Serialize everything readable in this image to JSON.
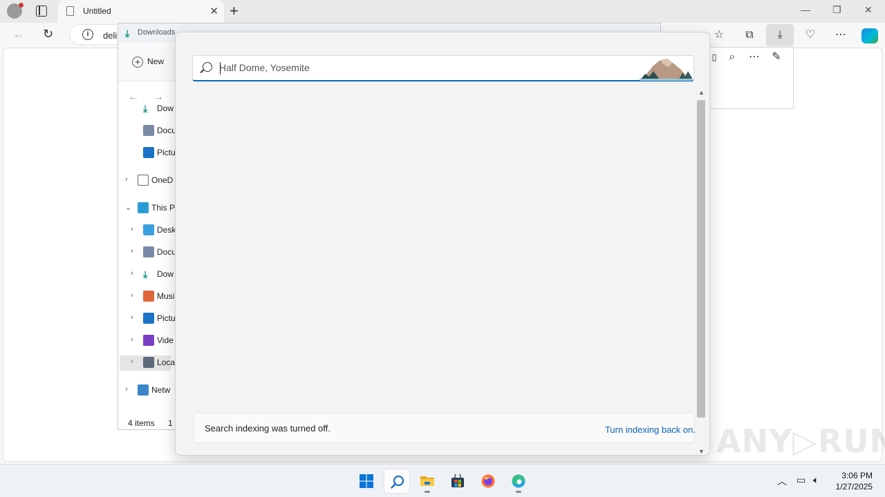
{
  "browser": {
    "tab_title": "Untitled",
    "tab_close": "✕",
    "new_tab": "+",
    "address_text": "deli",
    "window_controls": [
      "—",
      "❐",
      "✕"
    ],
    "toolbar_icons": [
      "split-screen-icon",
      "favorites-icon",
      "collections-icon",
      "downloads-icon",
      "performance-icon",
      "more-icon",
      "copilot-icon"
    ]
  },
  "explorer": {
    "title": "Downloads",
    "new_label": "New",
    "nav_items": [
      {
        "label": "Dow",
        "icon": "download-icon",
        "indent": 1
      },
      {
        "label": "Docu",
        "icon": "document-icon",
        "indent": 1
      },
      {
        "label": "Pictu",
        "icon": "pictures-icon",
        "indent": 1
      },
      {
        "label": "OneD",
        "icon": "onedrive-icon",
        "indent": 0
      },
      {
        "label": "This P",
        "icon": "pc-icon",
        "indent": 0
      },
      {
        "label": "Deskt",
        "icon": "desktop-icon",
        "indent": 1
      },
      {
        "label": "Docu",
        "icon": "document-icon",
        "indent": 1
      },
      {
        "label": "Dow",
        "icon": "download-icon",
        "indent": 1
      },
      {
        "label": "Musi",
        "icon": "music-icon",
        "indent": 1
      },
      {
        "label": "Pictu",
        "icon": "pictures-icon",
        "indent": 1
      },
      {
        "label": "Vide",
        "icon": "videos-icon",
        "indent": 1
      },
      {
        "label": "Loca",
        "icon": "drive-icon",
        "indent": 1
      },
      {
        "label": "Netw",
        "icon": "network-icon",
        "indent": 0
      }
    ],
    "status_items": "4 items",
    "status_selected": "1"
  },
  "search": {
    "placeholder": "Half Dome, Yosemite",
    "value": "",
    "index_message": "Search indexing was turned off.",
    "index_link": "Turn indexing back on."
  },
  "taskbar": {
    "apps": [
      "start-icon",
      "search-icon",
      "file-explorer-icon",
      "store-icon",
      "firefox-icon",
      "edge-icon"
    ],
    "time": "3:06 PM",
    "date": "1/27/2025"
  },
  "watermark": "ANY▷RUN"
}
